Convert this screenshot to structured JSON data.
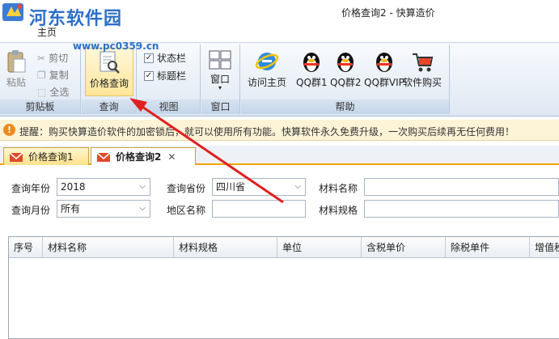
{
  "window": {
    "title": "价格查询2 - 快算造价",
    "watermark_text": "河东软件园",
    "watermark_url": "www.pc0359.cn"
  },
  "menu": {
    "home_label": "主页"
  },
  "ribbon": {
    "clipboard": {
      "paste_label": "粘贴",
      "cut_label": "剪切",
      "copy_label": "复制",
      "select_all_label": "全选",
      "group_label": "剪贴板"
    },
    "query": {
      "price_query_label": "价格查询",
      "group_label": "查询"
    },
    "view": {
      "statusbar_label": "状态栏",
      "titlebar_label": "标题栏",
      "group_label": "视图"
    },
    "window": {
      "window_label": "窗口",
      "group_label": "窗口"
    },
    "help": {
      "visit_home_label": "访问主页",
      "qq1_label": "QQ群1",
      "qq2_label": "QQ群2",
      "qqvip_label": "QQ群VIP",
      "buy_label": "软件购买",
      "group_label": "帮助"
    }
  },
  "notice": {
    "text": "提醒：购买快算造价软件的加密锁后，就可以使用所有功能。快算软件永久免费升级，一次购买后续再无任何费用！"
  },
  "tabs": [
    {
      "label": "价格查询1"
    },
    {
      "label": "价格查询2"
    }
  ],
  "form": {
    "year_label": "查询年份",
    "year_value": "2018",
    "month_label": "查询月份",
    "month_value": "所有",
    "province_label": "查询省份",
    "province_value": "四川省",
    "region_label": "地区名称",
    "material_name_label": "材料名称",
    "material_spec_label": "材料规格"
  },
  "grid": {
    "columns": [
      "序号",
      "材料名称",
      "材料规格",
      "单位",
      "含税单价",
      "除税单件",
      "增值税"
    ]
  },
  "colors": {
    "accent": "#f0a500",
    "ribbon_bg": "#dfe8f3",
    "notice_bg": "#fdf3d6",
    "annotation_arrow": "#e02020"
  }
}
